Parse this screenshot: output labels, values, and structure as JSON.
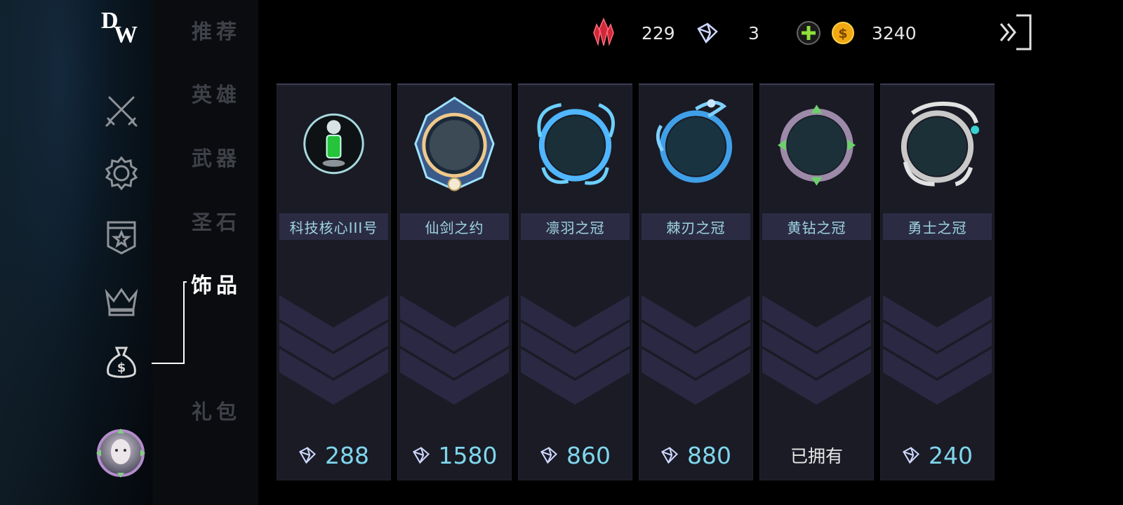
{
  "logo": "DW",
  "nav": {
    "items": [
      {
        "label": "推荐",
        "active": false
      },
      {
        "label": "英雄",
        "active": false
      },
      {
        "label": "武器",
        "active": false
      },
      {
        "label": "圣石",
        "active": false
      },
      {
        "label": "饰品",
        "active": true
      },
      {
        "label": "礼包",
        "active": false
      }
    ]
  },
  "resources": {
    "red_crystal": "229",
    "diamond": "3",
    "gold": "3240"
  },
  "colors": {
    "accent_price": "#7fd6ec",
    "name_text": "#9fd4e2",
    "card_bg": "#1a1b25",
    "namebar_bg": "#2b2c44",
    "chevron": "#2d2b4a"
  },
  "items": [
    {
      "name": "科技核心III号",
      "price": "288",
      "owned": false
    },
    {
      "name": "仙剑之约",
      "price": "1580",
      "owned": false
    },
    {
      "name": "凛羽之冠",
      "price": "860",
      "owned": false
    },
    {
      "name": "棘刃之冠",
      "price": "880",
      "owned": false
    },
    {
      "name": "黄钻之冠",
      "price": "",
      "owned": true,
      "owned_label": "已拥有"
    },
    {
      "name": "勇士之冠",
      "price": "240",
      "owned": false
    }
  ]
}
